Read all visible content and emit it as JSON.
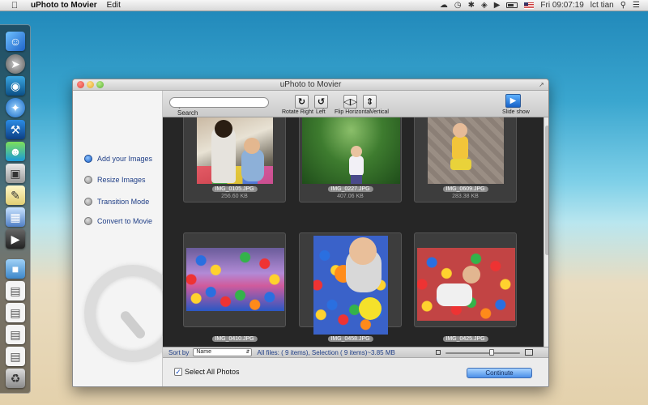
{
  "menubar": {
    "app_name": "uPhoto to Movier",
    "menu_edit": "Edit",
    "clock": "Fri 09:07:19",
    "user": "lct tian",
    "icons": [
      "apple-icon",
      "cloud-icon",
      "clock-icon",
      "bluetooth-icon",
      "wifi-icon",
      "volume-icon",
      "battery-icon",
      "flag-icon",
      "search-icon",
      "list-icon"
    ]
  },
  "dock": {
    "icons": [
      "finder-icon",
      "launchpad-icon",
      "dashboard-icon",
      "safari-icon",
      "xcode-icon",
      "messenger-icon",
      "photo-icon",
      "notes-icon",
      "preview-icon",
      "movie-icon",
      "folder-icon",
      "document-icon",
      "document-icon",
      "document-icon",
      "document-icon",
      "trash-icon"
    ]
  },
  "window": {
    "title": "uPhoto to Movier"
  },
  "toolbar": {
    "search_placeholder": "",
    "search_label": "Search",
    "rotate_right_label": "Rotate Right",
    "rotate_left_label": "Left",
    "flip_horizontal_label": "Flip Horizontal",
    "flip_vertical_label": "Vertical",
    "slideshow_label": "Slide show"
  },
  "sidebar": {
    "steps": [
      {
        "label": "Add your Images",
        "active": true
      },
      {
        "label": "Resize Images",
        "active": false
      },
      {
        "label": "Transition Mode",
        "active": false
      },
      {
        "label": "Convert to Movie",
        "active": false
      }
    ]
  },
  "gallery": {
    "photos": [
      {
        "name": "IMG_0105.JPG",
        "size": "256.60 KB"
      },
      {
        "name": "IMG_0227.JPG",
        "size": "407.06 KB"
      },
      {
        "name": "IMG_0609.JPG",
        "size": "283.38 KB"
      },
      {
        "name": "IMG_0410.JPG",
        "size": ""
      },
      {
        "name": "IMG_0458.JPG",
        "size": ""
      },
      {
        "name": "IMG_0425.JPG",
        "size": ""
      }
    ]
  },
  "bottombar": {
    "sortby_label": "Sort by",
    "sort_value": "Name",
    "files_info": "All files: ( 9 items), Selection ( 9 items)~3.85 MB",
    "zoom_level": 0.62
  },
  "footer": {
    "select_all_label": "Select All Photos",
    "select_all_checked": true,
    "continue_label": "Continute"
  }
}
